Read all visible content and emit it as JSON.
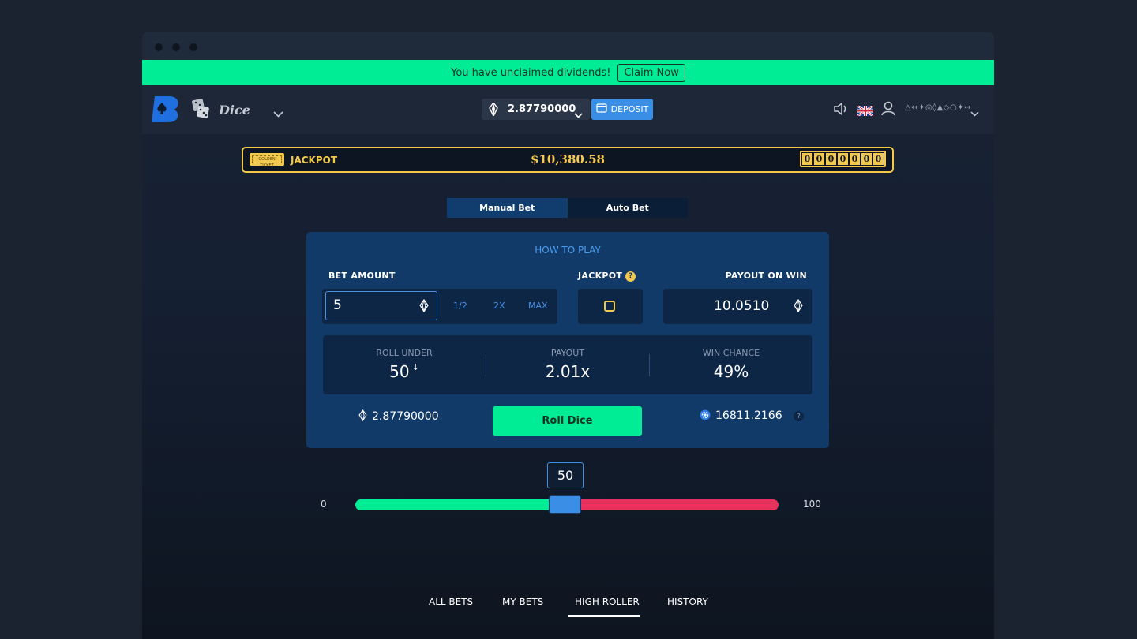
{
  "banner": {
    "message": "You have unclaimed dividends!",
    "claim_label": "Claim Now"
  },
  "header": {
    "logo_letter": "B",
    "game_title": "Dice",
    "balance": "2.87790000",
    "deposit_label": "DEPOSIT",
    "username": "△⁠↔⁠✦⁠◎⁠◊⁠▲⁠◇⁠○⁠✦⁠↔"
  },
  "jackpot": {
    "label": "JACKPOT",
    "amount": "$10,380.58",
    "digits": [
      "0",
      "0",
      "0",
      "0",
      "0",
      "0",
      "0"
    ],
    "ticket_text": "GOLDEN TICKET"
  },
  "bet_tabs": [
    "Manual Bet",
    "Auto Bet"
  ],
  "panel": {
    "how_to_play": "HOW TO PLAY",
    "bet_amount_label": "BET AMOUNT",
    "bet_amount_value": "5",
    "half_label": "1/2",
    "double_label": "2X",
    "max_label": "MAX",
    "jackpot_label": "JACKPOT",
    "jackpot_help": "?",
    "payout_on_win_label": "PAYOUT ON WIN",
    "payout_on_win_value": "10.0510",
    "roll_under_label": "ROLL UNDER",
    "roll_under_value": "50",
    "payout_label": "PAYOUT",
    "payout_value": "2.01x",
    "win_chance_label": "WIN CHANCE",
    "win_chance_value": "49%",
    "balance": "2.87790000",
    "roll_button": "Roll Dice",
    "token_balance": "16811.2166",
    "token_help": "?"
  },
  "slider": {
    "value": "50",
    "min": "0",
    "max": "100"
  },
  "bottom_tabs": [
    "ALL BETS",
    "MY BETS",
    "HIGH ROLLER",
    "HISTORY"
  ],
  "colors": {
    "accent_green": "#00ed96",
    "accent_blue": "#3b8ee6",
    "jackpot_gold": "#f2c94c",
    "lose_red": "#e8325e",
    "panel_blue": "#123a69"
  }
}
